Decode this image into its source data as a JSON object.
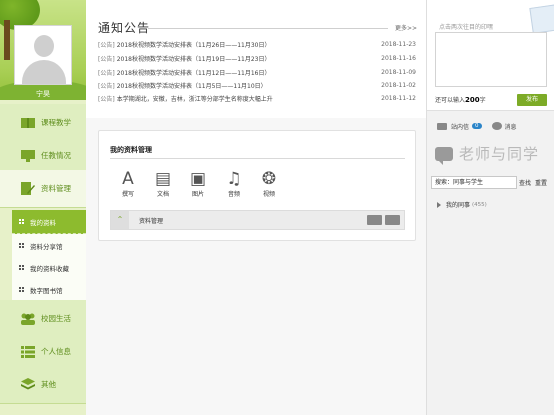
{
  "sidebar": {
    "username": "宁昊",
    "nav": {
      "course": "课程教学",
      "teaching": "任教情况",
      "resources": "资料管理",
      "campus": "校园生活",
      "personal": "个人信息",
      "other": "其他"
    },
    "sub": {
      "my_materials": "我的资料",
      "share": "资料分享馆",
      "favorites": "我的资料收藏",
      "library": "数字图书馆"
    }
  },
  "notice": {
    "title": "通知公告",
    "more": "更多>>",
    "tag": "[公告]",
    "items": [
      {
        "text": "2018秋视频数学活动安排表（11月26日——11月30日）",
        "date": "2018-11-23"
      },
      {
        "text": "2018秋视频数学活动安排表（11月19日——11月23日）",
        "date": "2018-11-16"
      },
      {
        "text": "2018秋视频数学活动安排表（11月12日——11月16日）",
        "date": "2018-11-09"
      },
      {
        "text": "2018秋视频数学活动安排表（11月5日——11月10日）",
        "date": "2018-11-02"
      },
      {
        "text": "本学期湖北，安徽，吉林，浙江等分部学生名称度大幅上升",
        "date": "2018-11-12"
      }
    ]
  },
  "materials": {
    "title": "我的资料管理",
    "tools": [
      "撰写",
      "文档",
      "图片",
      "音频",
      "视频"
    ],
    "folder_label": "资料管理"
  },
  "right": {
    "status_placeholder": "点击两次往目的印嘿",
    "count_prefix": "还可以输入",
    "count_value": "200",
    "count_suffix": "字",
    "publish": "发布",
    "inbox_label": "站内信",
    "inbox_count": "0",
    "messages_label": "消息",
    "section_title": "老师与同学",
    "search_value": "搜索：同事与学生",
    "search_btn": "查找",
    "reset_btn": "重置",
    "colleagues_label": "我的同事",
    "colleagues_count": "(455)"
  },
  "colors": {
    "accent": "#8dbb2e",
    "sidebar_bg": "#e7f1c9",
    "badge_blue": "#2a84c8"
  }
}
